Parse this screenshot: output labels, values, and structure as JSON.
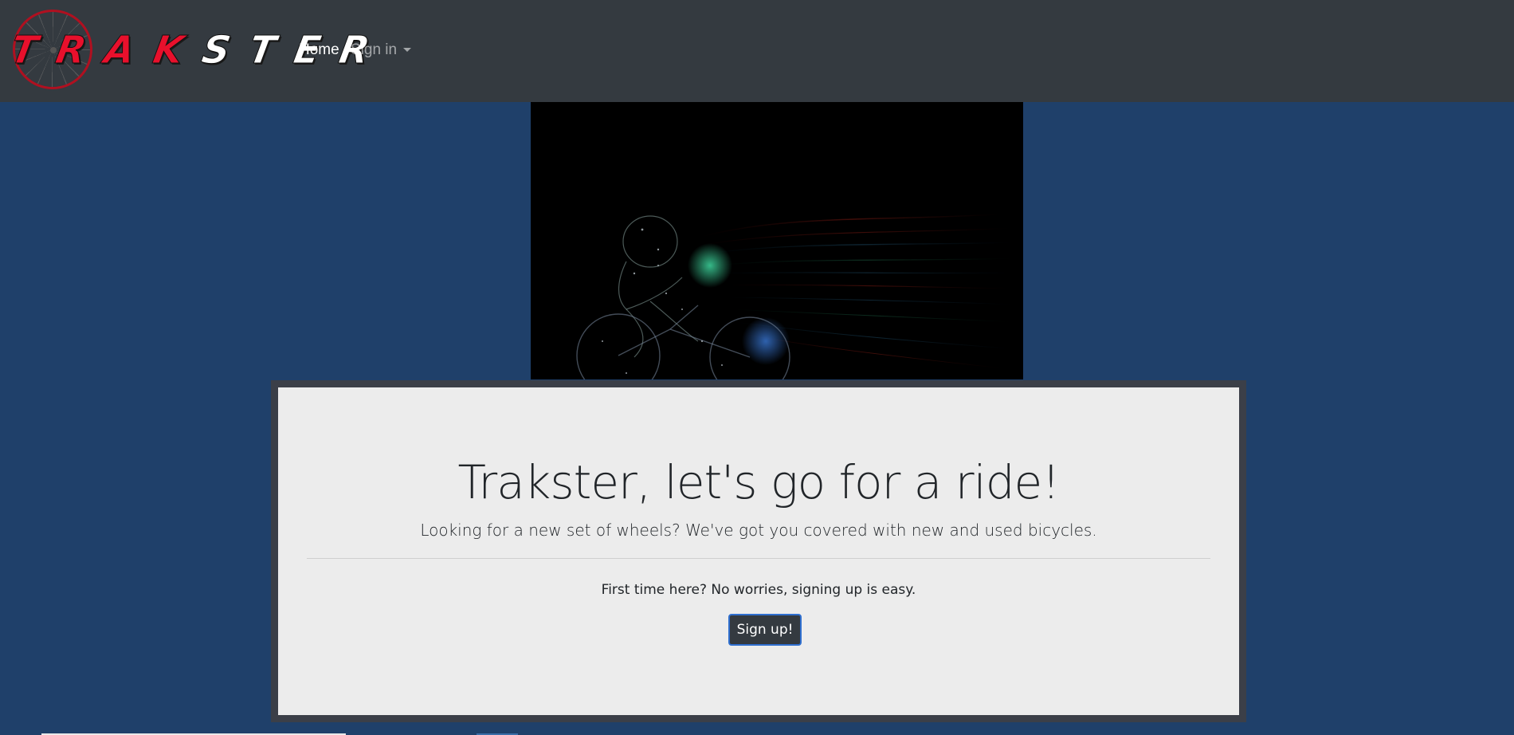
{
  "navbar": {
    "brand": {
      "letters_red": "TRAK",
      "letters_white": "STER"
    },
    "links": {
      "home": "Home",
      "signin": "Sign in"
    }
  },
  "hero": {
    "headline": "Trakster, let's go for a ride!",
    "lead": "Looking for a new set of wheels? We've got you covered with new and used bicycles.",
    "note": "First time here? No worries, signing up is easy.",
    "signup_label": "Sign up!"
  },
  "colors": {
    "page_bg": "#1f406a",
    "navbar_bg": "#343a40",
    "card_border": "#3b3f48",
    "card_bg": "#ececec",
    "brand_red": "#e8102c",
    "button_bg": "#343a40",
    "button_border": "#2f6fcf"
  },
  "icons": {
    "signin_caret": "chevron-down-icon",
    "logo_wheel": "bicycle-wheel-icon"
  }
}
